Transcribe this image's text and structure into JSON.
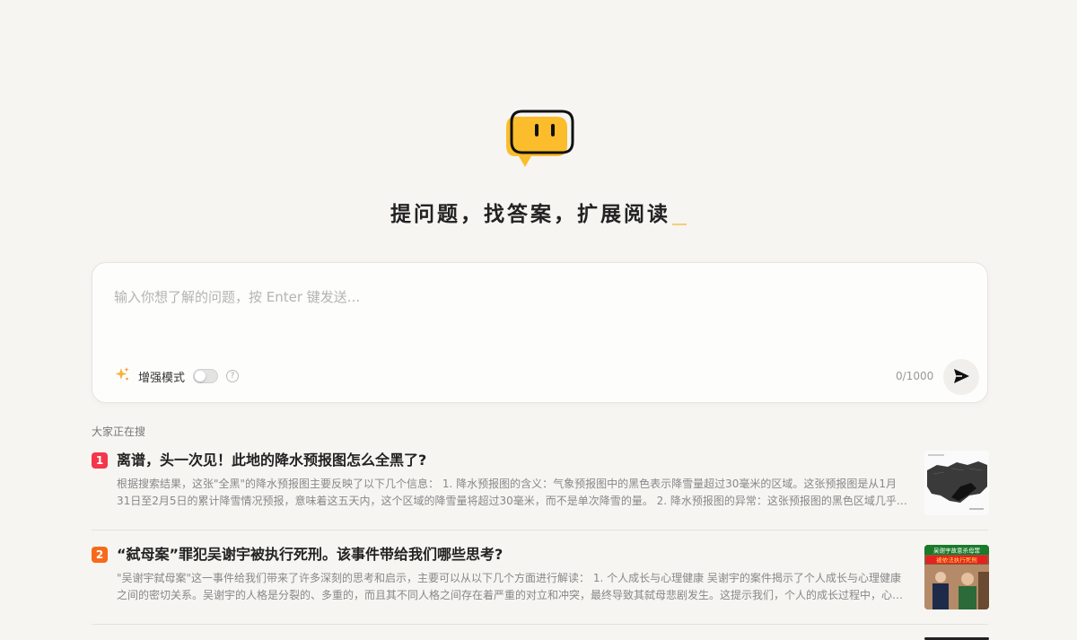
{
  "hero": {
    "headline": "提问题，找答案，扩展阅读"
  },
  "search": {
    "placeholder": "输入你想了解的问题，按 Enter 键发送...",
    "value": "",
    "enhance_label": "增强模式",
    "enhance_enabled": false,
    "counter": "0/1000"
  },
  "trending": {
    "label": "大家正在搜",
    "items": [
      {
        "rank": "1",
        "rank_color": "#f5364a",
        "title": "离谱，头一次见！此地的降水预报图怎么全黑了?",
        "snippet": "根据搜索结果，这张\"全黑\"的降水预报图主要反映了以下几个信息： 1. 降水预报图的含义：气象预报图中的黑色表示降雪量超过30毫米的区域。这张预报图是从1月31日至2月5日的累计降雪情况预报，意味着这五天内，这个区域的降雪量将超过30毫米，而不是单次降雪的量。 2. 降水预报图的异常：这张预报图的黑色区域几乎覆盖了..."
      },
      {
        "rank": "2",
        "rank_color": "#f76a1a",
        "title": "“弑母案”罪犯吴谢宇被执行死刑。该事件带给我们哪些思考?",
        "snippet": "\"吴谢宇弑母案\"这一事件给我们带来了许多深刻的思考和启示，主要可以从以下几个方面进行解读： 1. 个人成长与心理健康 吴谢宇的案件揭示了个人成长与心理健康之间的密切关系。吴谢宇的人格是分裂的、多重的，而且其不同人格之间存在着严重的对立和冲突，最终导致其弑母悲剧发生。这提示我们，个人的成长过程中，心理...",
        "thumb_caption_top": "吴谢宇故意杀母罪",
        "thumb_caption_bottom": "被依法执行死刑"
      }
    ]
  },
  "colors": {
    "background": "#f6f5f2",
    "logo_yellow": "#fbbd2c",
    "accent_cursor": "#f5cd7a"
  }
}
